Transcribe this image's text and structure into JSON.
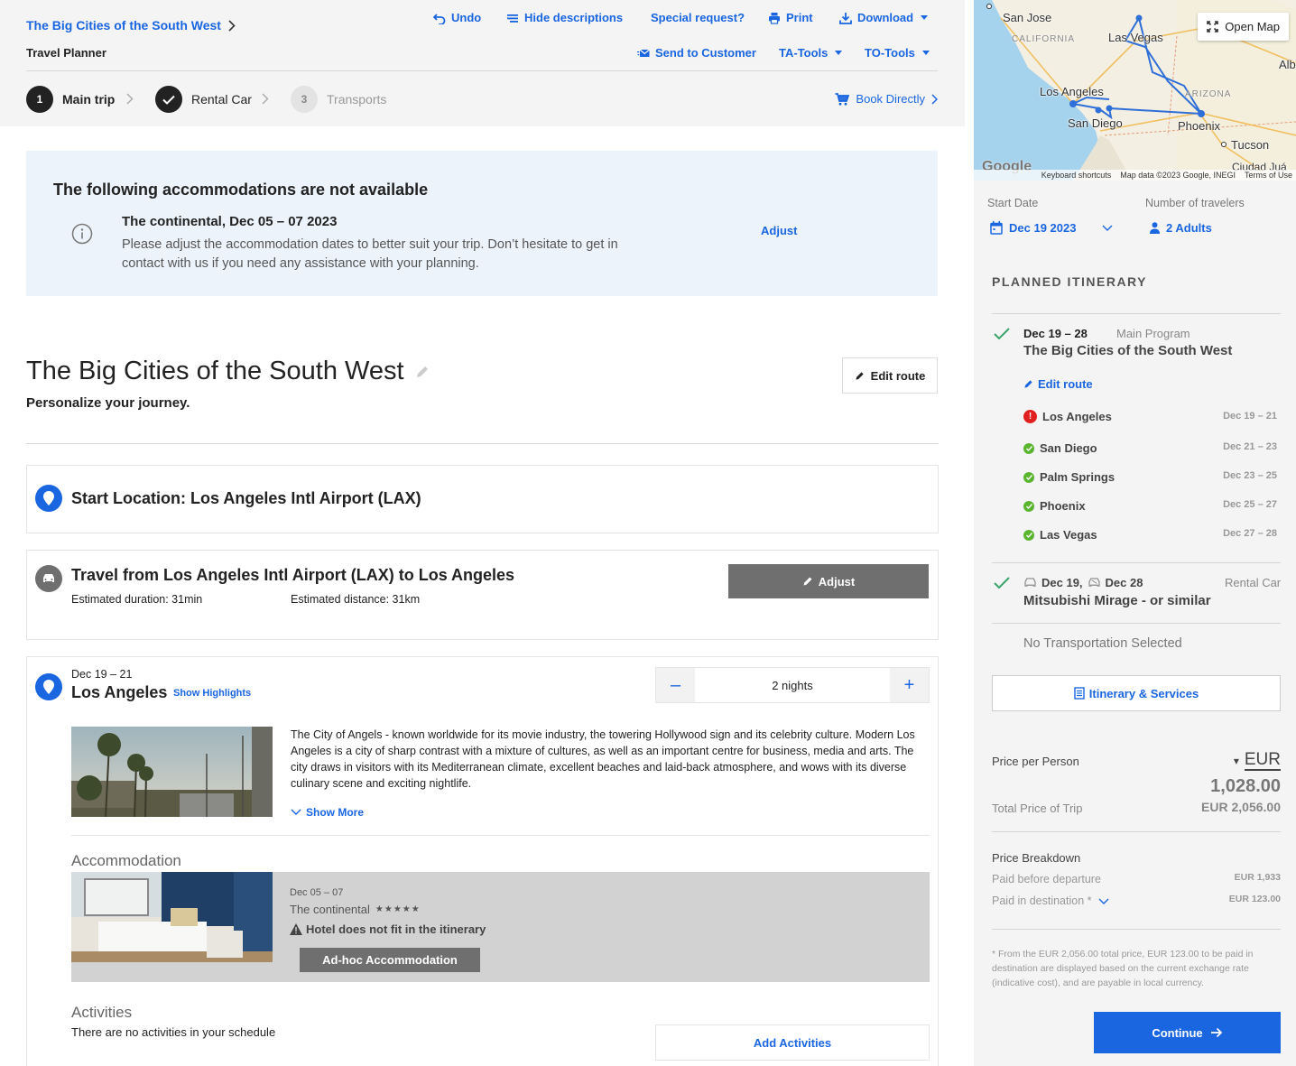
{
  "header": {
    "breadcrumb": "The Big Cities of the South West",
    "planner_label": "Travel Planner",
    "toolbar": {
      "undo": "Undo",
      "hide_descriptions": "Hide descriptions",
      "special_request": "Special request?",
      "print": "Print",
      "download": "Download",
      "send_to_customer": "Send to Customer",
      "ta_tools": "TA-Tools",
      "to_tools": "TO-Tools"
    },
    "steps": [
      {
        "number": "1",
        "label": "Main trip"
      },
      {
        "number": "",
        "label": "Rental Car"
      },
      {
        "number": "3",
        "label": "Transports"
      }
    ],
    "book_directly": "Book Directly"
  },
  "alert": {
    "title": "The following accommodations are not available",
    "subtitle": "The continental, Dec 05 – 07 2023",
    "body": "Please adjust the accommodation dates to better suit your trip. Don’t hesitate to get in contact with us if you need any assistance with your planning.",
    "adjust": "Adjust"
  },
  "trip": {
    "title": "The Big Cities of the South West",
    "subtitle": "Personalize your journey.",
    "edit_route": "Edit route"
  },
  "start_location": {
    "title": "Start Location: Los Angeles Intl Airport (LAX)"
  },
  "travel": {
    "title": "Travel from Los Angeles Intl Airport (LAX) to Los Angeles",
    "duration": "Estimated duration: 31min",
    "distance": "Estimated distance: 31km",
    "adjust": "Adjust"
  },
  "destination": {
    "dates": "Dec 19 – 21",
    "name": "Los Angeles",
    "show_highlights": "Show Highlights",
    "nights": "2 nights",
    "minus": "–",
    "plus": "+",
    "description": "The City of Angels - known worldwide for its movie industry, the towering Hollywood sign and its celebrity culture. Modern Los Angeles is a city of sharp contrast with a mixture of cultures, as well as an important centre for business, media and arts. The city draws in visitors with its Mediterranean climate, excellent beaches and laid-back atmosphere, and wows with its diverse culinary scene and exciting nightlife.",
    "show_more": "Show More",
    "accommodation_label": "Accommodation",
    "accommodation": {
      "dates": "Dec 05 – 07",
      "hotel": "The continental",
      "stars": "★★★★★",
      "warning": "Hotel does not fit in the itinerary",
      "adhoc": "Ad-hoc Accommodation"
    },
    "activities_label": "Activities",
    "activities_empty": "There are no activities in your schedule",
    "add_activities": "Add Activities"
  },
  "map": {
    "open_map": "Open Map",
    "cities": [
      "San Jose",
      "Las Vegas",
      "Los Angeles",
      "San Diego",
      "Phoenix",
      "Tucson",
      "Albu",
      "Ciudad Juá"
    ],
    "states": [
      "CALIFORNIA",
      "ARIZONA"
    ],
    "google": "Google",
    "keyboard_shortcuts": "Keyboard shortcuts",
    "map_data": "Map data ©2023 Google, INEGI",
    "terms": "Terms of Use"
  },
  "sidebar": {
    "start_date_label": "Start Date",
    "start_date": "Dec 19 2023",
    "travelers_label": "Number of travelers",
    "travelers": "2 Adults",
    "planned_itinerary": "PLANNED ITINERARY",
    "main_program": {
      "dates": "Dec 19 – 28",
      "type": "Main Program",
      "title": "The Big Cities of the South West",
      "edit_route": "Edit route"
    },
    "cities": [
      {
        "name": "Los Angeles",
        "dates": "Dec 19 – 21",
        "status": "error"
      },
      {
        "name": "San Diego",
        "dates": "Dec 21 – 23",
        "status": "ok"
      },
      {
        "name": "Palm Springs",
        "dates": "Dec 23 – 25",
        "status": "ok"
      },
      {
        "name": "Phoenix",
        "dates": "Dec 25 – 27",
        "status": "ok"
      },
      {
        "name": "Las Vegas",
        "dates": "Dec 27 – 28",
        "status": "ok"
      }
    ],
    "rental_car": {
      "pickup": "Dec 19,",
      "dropoff": "Dec 28",
      "type": "Rental Car",
      "name": "Mitsubishi Mirage - or similar"
    },
    "no_transport": "No Transportation Selected",
    "itinerary_services": "Itinerary & Services",
    "price_per_person_label": "Price per Person",
    "currency": "EUR",
    "price_per_person": "1,028.00",
    "total_label": "Total Price of Trip",
    "total": "EUR 2,056.00",
    "breakdown_label": "Price Breakdown",
    "paid_before_label": "Paid before departure",
    "paid_before": "EUR 1,933",
    "paid_destination_label": "Paid in destination *",
    "paid_destination": "EUR 123.00",
    "footnote": "* From the EUR 2,056.00 total price, EUR 123.00 to be paid in destination are displayed based on the current exchange rate (indicative cost), and are payable in local currency.",
    "continue": "Continue"
  },
  "colors": {
    "accent": "#1a66e0",
    "alert_bg": "#edf3fb",
    "ok": "#5cb531",
    "error": "#e02020",
    "disabled_button": "#6f6f6f"
  }
}
